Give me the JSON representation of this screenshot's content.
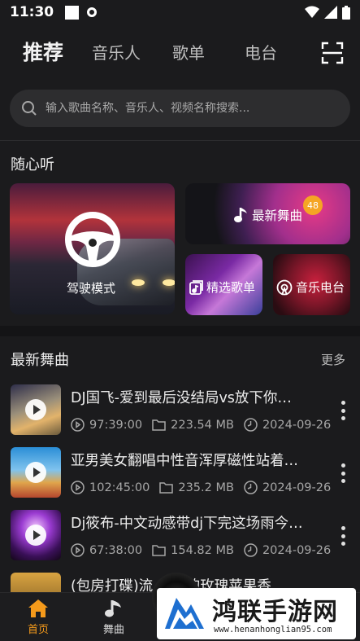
{
  "status_bar": {
    "time": "11:30"
  },
  "top_nav": {
    "tabs": [
      {
        "label": "推荐",
        "active": true
      },
      {
        "label": "音乐人",
        "active": false
      },
      {
        "label": "歌单",
        "active": false
      },
      {
        "label": "电台",
        "active": false
      }
    ],
    "scan_icon": "scan-frame-icon"
  },
  "search": {
    "placeholder": "输入歌曲名称、音乐人、视频名称搜索..."
  },
  "random_listen": {
    "title": "随心听",
    "cards": {
      "drive": "驾驶模式",
      "new_dance": "最新舞曲",
      "new_dance_badge": "48",
      "picked_playlist": "精选歌单",
      "music_radio": "音乐电台"
    }
  },
  "latest_dance": {
    "title": "最新舞曲",
    "more": "更多",
    "songs": [
      {
        "title": "DJ国飞-爱到最后没结局vs放下你…",
        "duration": "97:39:00",
        "size": "223.54 MB",
        "date": "2024-09-26"
      },
      {
        "title": "亚男美女翻唱中性音浑厚磁性站着…",
        "duration": "102:45:00",
        "size": "235.2 MB",
        "date": "2024-09-26"
      },
      {
        "title": "Dj筱布-中文动感带dj下完这场雨今…",
        "duration": "67:38:00",
        "size": "154.82 MB",
        "date": "2024-09-26"
      },
      {
        "title": "(包房打碟)流…    …的玫瑰苹果香"
      }
    ]
  },
  "bottom_nav": {
    "items": [
      {
        "label": "首页",
        "active": true
      },
      {
        "label": "舞曲",
        "active": false
      }
    ]
  },
  "watermark": {
    "name": "鸿联手游网",
    "url": "www.henanhonglian95.com"
  },
  "colors": {
    "accent": "#f59a1b",
    "background": "#1b1b1d",
    "badge": "#f5a524"
  }
}
